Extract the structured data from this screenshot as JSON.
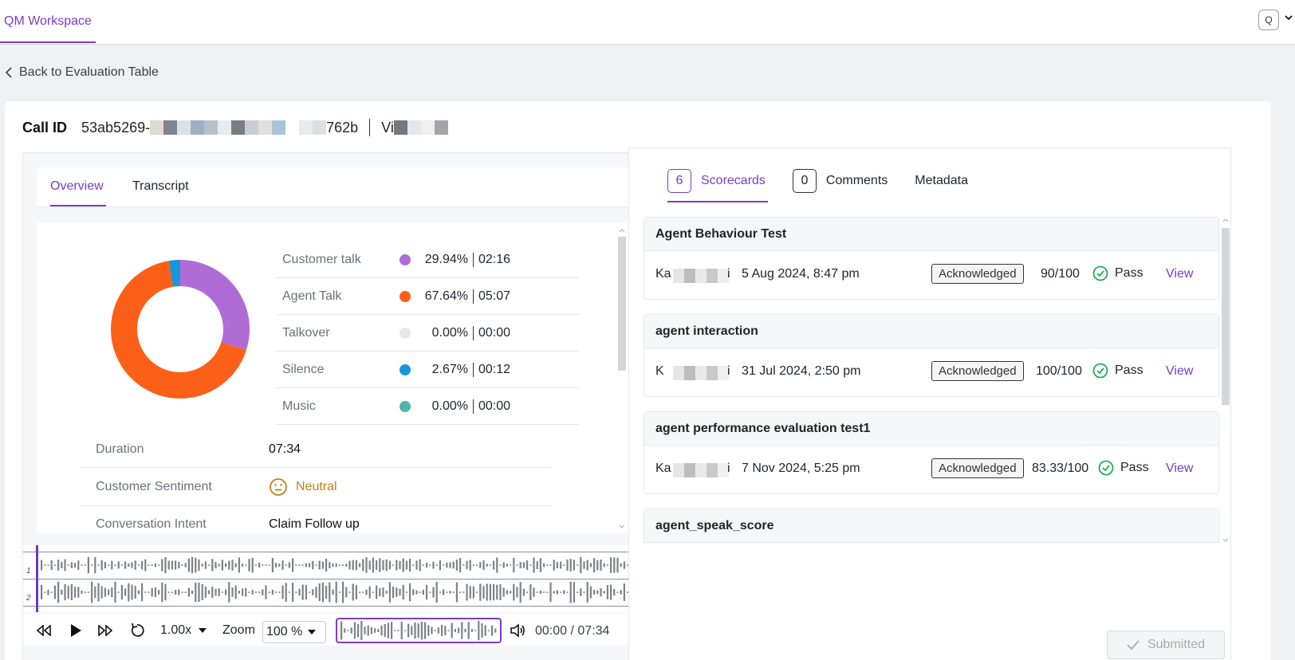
{
  "topbar": {
    "tab": "QM Workspace",
    "avatar_initial": "Q"
  },
  "back_link": "Back to Evaluation Table",
  "call": {
    "label": "Call ID",
    "id_prefix": "53ab5269-",
    "id_suffix": "762b",
    "agent_prefix": "Vi"
  },
  "left_tabs": [
    {
      "label": "Overview",
      "active": true
    },
    {
      "label": "Transcript",
      "active": false
    }
  ],
  "talk_breakdown": [
    {
      "name": "Customer talk",
      "pct": "29.94%",
      "time": "02:16",
      "color": "#b06cd6",
      "value": 29.94
    },
    {
      "name": "Agent Talk",
      "pct": "67.64%",
      "time": "05:07",
      "color": "#fc5f17",
      "value": 67.64
    },
    {
      "name": "Talkover",
      "pct": "0.00%",
      "time": "00:00",
      "color": "#e6e7ea",
      "value": 0
    },
    {
      "name": "Silence",
      "pct": "2.67%",
      "time": "00:12",
      "color": "#1796d8",
      "value": 2.67
    },
    {
      "name": "Music",
      "pct": "0.00%",
      "time": "00:00",
      "color": "#4fb6ac",
      "value": 0
    }
  ],
  "info": [
    {
      "key": "Duration",
      "value": "07:34"
    },
    {
      "key": "Customer Sentiment",
      "value": "Neutral",
      "icon": "neutral-face-icon"
    },
    {
      "key": "Conversation Intent",
      "value": "Claim Follow up"
    }
  ],
  "player": {
    "speed": "1.00x",
    "zoom_label": "Zoom",
    "zoom_value": "100 %",
    "current": "00:00",
    "total": "07:34",
    "channels": [
      "1",
      "2"
    ]
  },
  "right_tabs": [
    {
      "count": "6",
      "label": "Scorecards",
      "active": true
    },
    {
      "count": "0",
      "label": "Comments",
      "active": false
    },
    {
      "label": "Metadata",
      "active": false
    }
  ],
  "scorecards": [
    {
      "title": "Agent Behaviour Test",
      "evaluator_first": "Ka",
      "evaluator_last": "i",
      "date": "5 Aug 2024, 8:47 pm",
      "status": "Acknowledged",
      "score": "90/100",
      "result": "Pass",
      "action": "View"
    },
    {
      "title": "agent interaction",
      "evaluator_first": "K",
      "evaluator_last": "i",
      "date": "31 Jul 2024, 2:50 pm",
      "status": "Acknowledged",
      "score": "100/100",
      "result": "Pass",
      "action": "View"
    },
    {
      "title": "agent performance evaluation test1",
      "evaluator_first": "Ka",
      "evaluator_last": "i",
      "date": "7 Nov 2024, 5:25 pm",
      "status": "Acknowledged",
      "score": "83.33/100",
      "result": "Pass",
      "action": "View"
    },
    {
      "title": "agent_speak_score"
    }
  ],
  "submit_label": "Submitted"
}
